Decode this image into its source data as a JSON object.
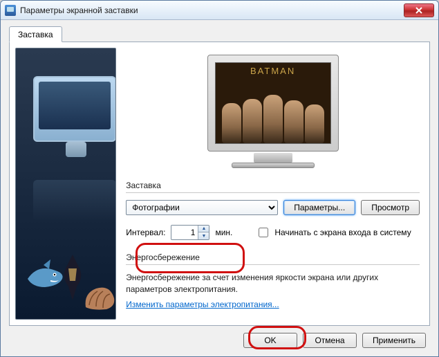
{
  "window": {
    "title": "Параметры экранной заставки"
  },
  "tab": {
    "label": "Заставка"
  },
  "preview": {
    "movie_title": "BATMAN"
  },
  "saver": {
    "group_label": "Заставка",
    "selected": "Фотографии",
    "settings_btn": "Параметры...",
    "preview_btn": "Просмотр"
  },
  "interval": {
    "label": "Интервал:",
    "value": "1",
    "unit": "мин.",
    "checkbox_label": "Начинать с экрана входа в систему"
  },
  "power": {
    "group_label": "Энергосбережение",
    "text": "Энергосбережение за счет изменения яркости экрана или других параметров электропитания.",
    "link": "Изменить параметры электропитания..."
  },
  "buttons": {
    "ok": "OK",
    "cancel": "Отмена",
    "apply": "Применить"
  }
}
